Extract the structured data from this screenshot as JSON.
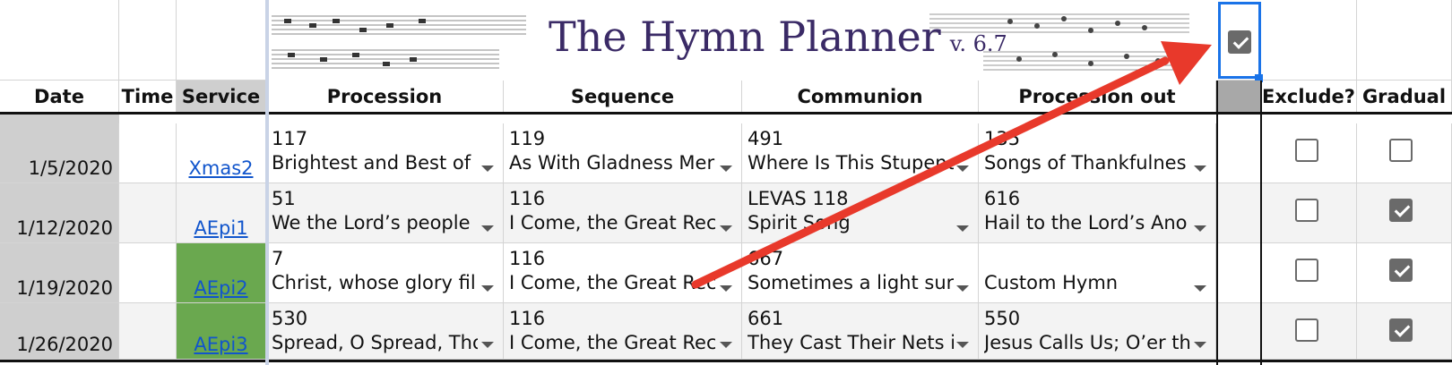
{
  "banner": {
    "title": "The Hymn Planner",
    "version": "v. 6.7",
    "checkbox_checked": true
  },
  "headers": {
    "date": "Date",
    "time": "Time",
    "service": "Service",
    "procession": "Procession",
    "sequence": "Sequence",
    "communion": "Communion",
    "procession_out": "Procession out",
    "exclude": "Exclude?",
    "gradual": "Gradual"
  },
  "rows": [
    {
      "date": "1/5/2020",
      "service": "Xmas2",
      "service_highlight": false,
      "procession": {
        "num": "117",
        "title": "Brightest and Best of"
      },
      "sequence": {
        "num": "119",
        "title": "As With Gladness Mer"
      },
      "communion": {
        "num": "491",
        "title": "Where Is This Stupend"
      },
      "procession_out": {
        "num": "135",
        "title": "Songs of Thankfulnes"
      },
      "exclude": false,
      "gradual": false
    },
    {
      "date": "1/12/2020",
      "service": "AEpi1",
      "service_highlight": false,
      "procession": {
        "num": "51",
        "title": "We the Lord’s people"
      },
      "sequence": {
        "num": "116",
        "title": "I Come, the Great Rec"
      },
      "communion": {
        "num": "LEVAS 118",
        "title": "Spirit Song"
      },
      "procession_out": {
        "num": "616",
        "title": "Hail to the Lord’s Ano"
      },
      "exclude": false,
      "gradual": true
    },
    {
      "date": "1/19/2020",
      "service": "AEpi2",
      "service_highlight": true,
      "procession": {
        "num": "7",
        "title": "Christ, whose glory fil"
      },
      "sequence": {
        "num": "116",
        "title": "I Come, the Great Rec"
      },
      "communion": {
        "num": "667",
        "title": "Sometimes a light sur"
      },
      "procession_out": {
        "num": "",
        "title": "Custom Hymn"
      },
      "exclude": false,
      "gradual": true
    },
    {
      "date": "1/26/2020",
      "service": "AEpi3",
      "service_highlight": true,
      "procession": {
        "num": "530",
        "title": "Spread, O Spread, Tho"
      },
      "sequence": {
        "num": "116",
        "title": "I Come, the Great Rec"
      },
      "communion": {
        "num": "661",
        "title": "They Cast Their Nets i"
      },
      "procession_out": {
        "num": "550",
        "title": "Jesus Calls Us; O’er th"
      },
      "exclude": false,
      "gradual": true
    }
  ],
  "annotation": {
    "type": "red-arrow",
    "color": "#e8392b"
  },
  "colors": {
    "service_green": "#6aa84f",
    "date_gray": "#cfcfcf",
    "link_blue": "#1155cc",
    "selection_blue": "#1a73e8"
  }
}
